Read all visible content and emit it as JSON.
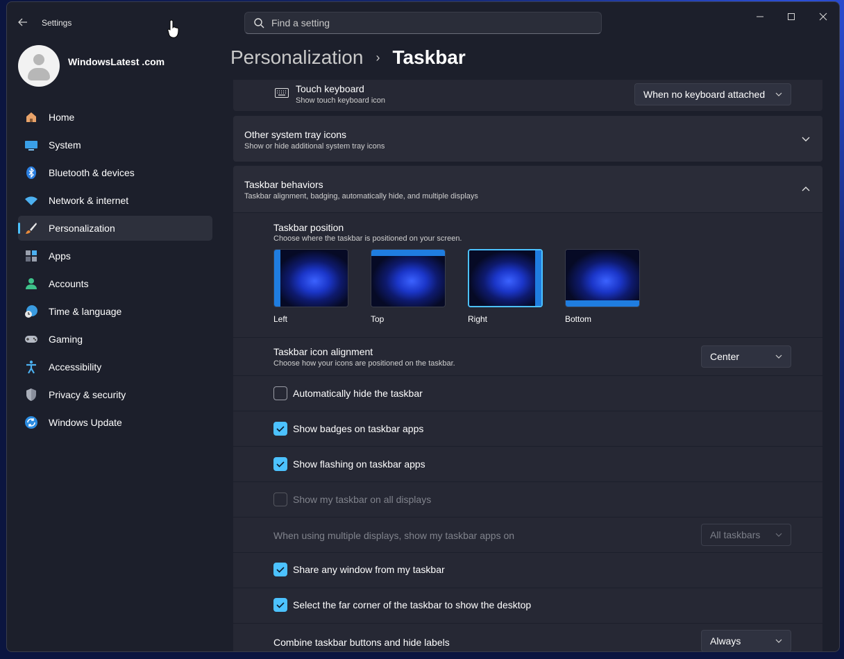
{
  "window": {
    "app_title": "Settings"
  },
  "search": {
    "placeholder": "Find a setting"
  },
  "profile": {
    "name": "WindowsLatest .com",
    "email": ""
  },
  "nav": {
    "items": [
      {
        "label": "Home",
        "icon": "home-icon"
      },
      {
        "label": "System",
        "icon": "system-icon"
      },
      {
        "label": "Bluetooth & devices",
        "icon": "bluetooth-icon"
      },
      {
        "label": "Network & internet",
        "icon": "wifi-icon"
      },
      {
        "label": "Personalization",
        "icon": "brush-icon",
        "active": true
      },
      {
        "label": "Apps",
        "icon": "apps-icon"
      },
      {
        "label": "Accounts",
        "icon": "account-icon"
      },
      {
        "label": "Time & language",
        "icon": "globe-clock-icon"
      },
      {
        "label": "Gaming",
        "icon": "gamepad-icon"
      },
      {
        "label": "Accessibility",
        "icon": "accessibility-icon"
      },
      {
        "label": "Privacy & security",
        "icon": "shield-icon"
      },
      {
        "label": "Windows Update",
        "icon": "update-icon"
      }
    ]
  },
  "breadcrumb": {
    "parent": "Personalization",
    "separator": "›",
    "current": "Taskbar"
  },
  "touch_keyboard": {
    "title": "Touch keyboard",
    "subtitle": "Show touch keyboard icon",
    "value": "When no keyboard attached"
  },
  "other_tray": {
    "title": "Other system tray icons",
    "subtitle": "Show or hide additional system tray icons"
  },
  "behaviors": {
    "title": "Taskbar behaviors",
    "subtitle": "Taskbar alignment, badging, automatically hide, and multiple displays",
    "position": {
      "title": "Taskbar position",
      "subtitle": "Choose where the taskbar is positioned on your screen.",
      "options": [
        {
          "label": "Left",
          "selected": false
        },
        {
          "label": "Top",
          "selected": false
        },
        {
          "label": "Right",
          "selected": true
        },
        {
          "label": "Bottom",
          "selected": false
        }
      ]
    },
    "alignment": {
      "title": "Taskbar icon alignment",
      "subtitle": "Choose how your icons are positioned on the taskbar.",
      "value": "Center"
    },
    "auto_hide": {
      "label": "Automatically hide the taskbar",
      "checked": false
    },
    "badges": {
      "label": "Show badges on taskbar apps",
      "checked": true
    },
    "flashing": {
      "label": "Show flashing on taskbar apps",
      "checked": true
    },
    "all_displays": {
      "label": "Show my taskbar on all displays",
      "checked": false,
      "disabled": true
    },
    "multi_display": {
      "label": "When using multiple displays, show my taskbar apps on",
      "value": "All taskbars",
      "disabled": true
    },
    "share_window": {
      "label": "Share any window from my taskbar",
      "checked": true
    },
    "far_corner": {
      "label": "Select the far corner of the taskbar to show the desktop",
      "checked": true
    },
    "combine": {
      "label": "Combine taskbar buttons and hide labels",
      "value": "Always"
    }
  },
  "colors": {
    "accent": "#4cc2ff",
    "window_bg": "#1c1f2b",
    "card_bg": "#2a2c38"
  }
}
